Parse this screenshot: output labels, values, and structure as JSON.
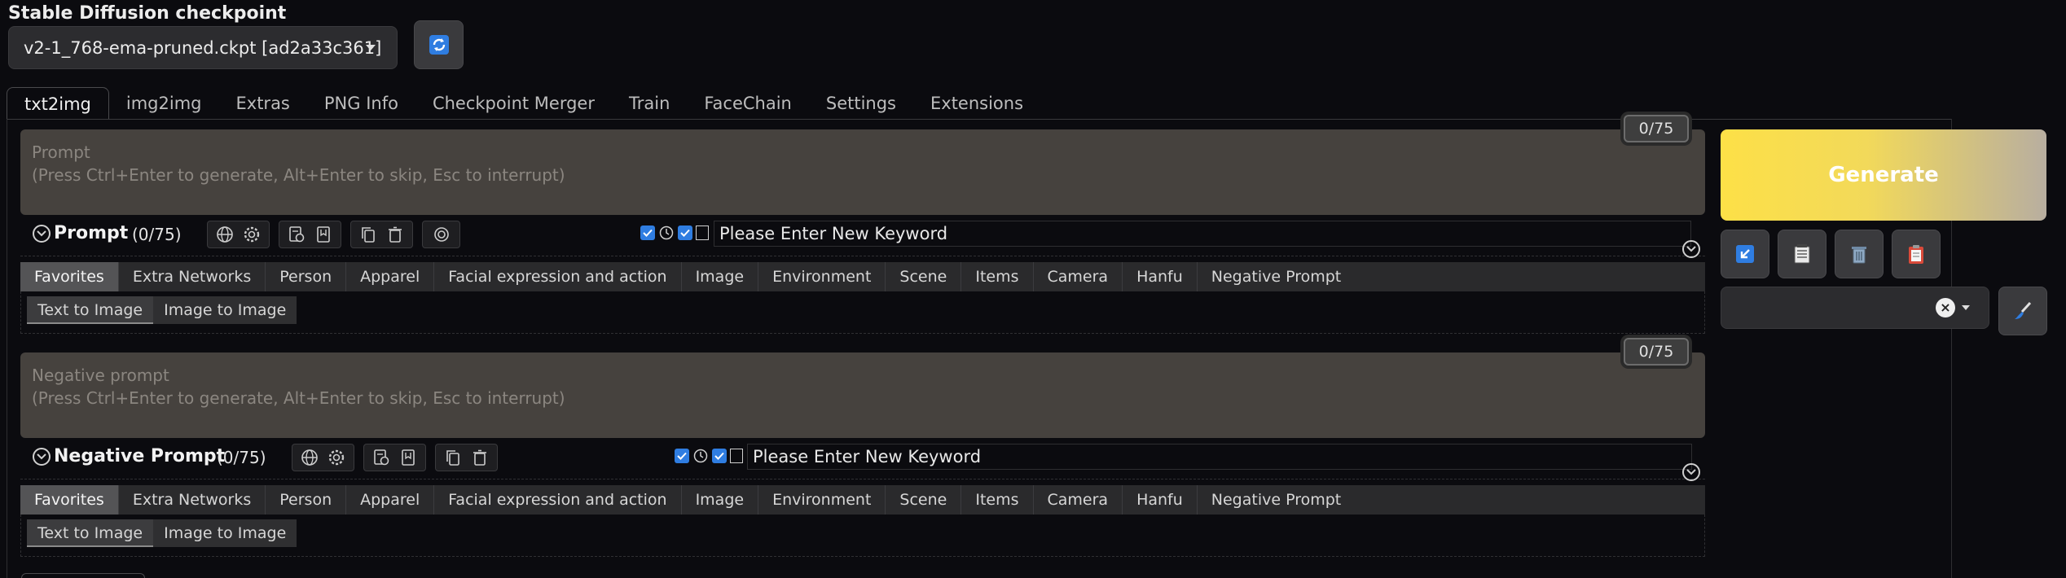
{
  "checkpoint": {
    "title": "Stable Diffusion checkpoint",
    "selected": "v2-1_768-ema-pruned.ckpt [ad2a33c361]"
  },
  "tabs": [
    {
      "label": "txt2img",
      "active": true
    },
    {
      "label": "img2img"
    },
    {
      "label": "Extras"
    },
    {
      "label": "PNG Info"
    },
    {
      "label": "Checkpoint Merger"
    },
    {
      "label": "Train"
    },
    {
      "label": "FaceChain"
    },
    {
      "label": "Settings"
    },
    {
      "label": "Extensions"
    }
  ],
  "prompt": {
    "placeholder_line1": "Prompt",
    "placeholder_line2": "(Press Ctrl+Enter to generate, Alt+Enter to skip, Esc to interrupt)",
    "token_counter": "0/75",
    "label": "Prompt",
    "count": "(0/75)",
    "keyword_placeholder": "Please Enter New Keyword"
  },
  "negative_prompt": {
    "placeholder_line1": "Negative prompt",
    "placeholder_line2": "(Press Ctrl+Enter to generate, Alt+Enter to skip, Esc to interrupt)",
    "token_counter": "0/75",
    "label": "Negative Prompt",
    "count": "(0/75)",
    "keyword_placeholder": "Please Enter New Keyword"
  },
  "categories": [
    "Favorites",
    "Extra Networks",
    "Person",
    "Apparel",
    "Facial expression and action",
    "Image",
    "Environment",
    "Scene",
    "Items",
    "Camera",
    "Hanfu",
    "Negative Prompt"
  ],
  "sub_tabs": [
    "Text to Image",
    "Image to Image"
  ],
  "generate_label": "Generate",
  "colors": {
    "generate_start": "#fde047",
    "generate_end": "#b8aea0",
    "checkbox_blue": "#2f7de1",
    "prompt_bg": "#46423e"
  },
  "icons": {
    "refresh": "refresh-icon",
    "read_params": "arrow-down-left-icon",
    "paste": "notepad-icon",
    "trash": "trash-icon",
    "clipboard": "clipboard-icon",
    "brush": "paintbrush-icon"
  }
}
